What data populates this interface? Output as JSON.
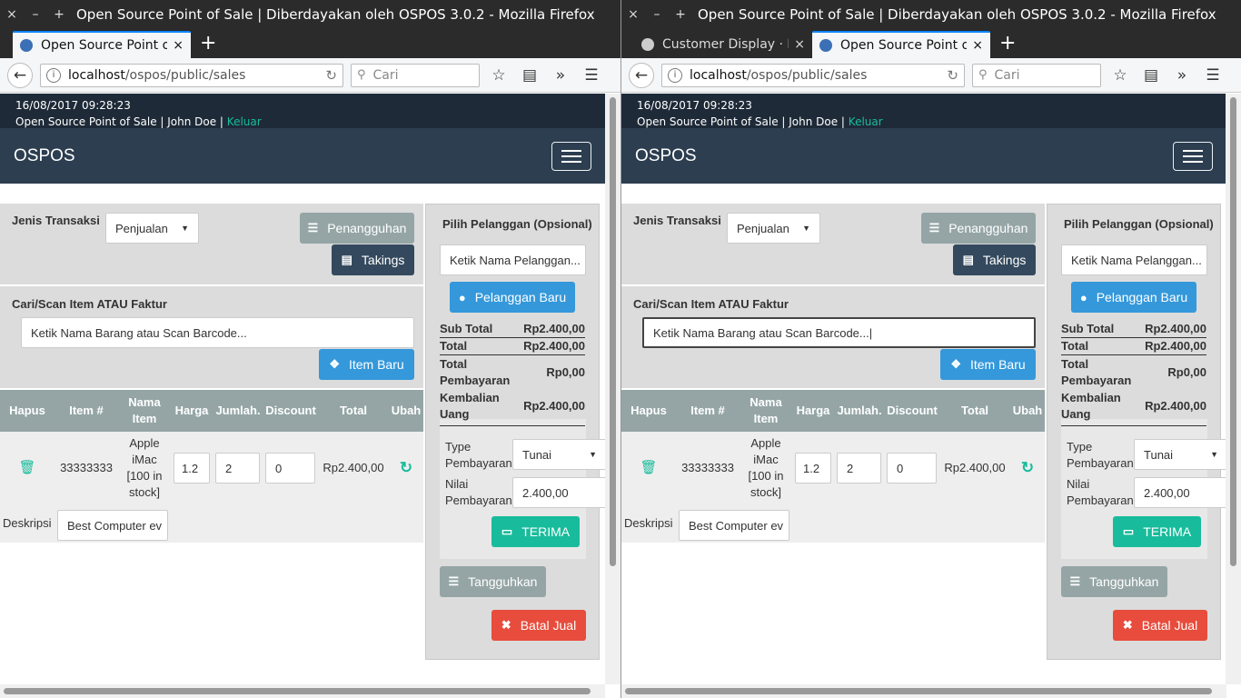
{
  "browser": {
    "title": "Open Source Point of Sale | Diberdayakan oleh OSPOS 3.0.2 - Mozilla Firefox",
    "controls": {
      "close": "×",
      "minimize": "–",
      "maximize": "+"
    },
    "tabs_left": [
      {
        "label": "Open Source Point of Sale | Diberdayakan oleh OSPOS",
        "close": "×"
      }
    ],
    "tabs_right": [
      {
        "label": "Customer Display · Issues",
        "close": "×"
      },
      {
        "label": "Open Source Point of Sale | Diberdayakan oleh OSPOS",
        "close": "×"
      }
    ],
    "new_tab": "+",
    "url_host": "localhost",
    "url_path": "/ospos/public/sales",
    "search_placeholder": "Cari",
    "icons": {
      "back": "arrow-left-icon",
      "reload": "reload-icon",
      "search": "search-icon",
      "bookmark": "star-icon",
      "library": "clipboard-icon",
      "overflow": "chevrons-icon",
      "menu": "hamburger-icon"
    }
  },
  "app": {
    "datetime": "16/08/2017 09:28:23",
    "user_line": "Open Source Point of Sale | John Doe | ",
    "logout": "Keluar",
    "brand": "OSPOS",
    "colors": {
      "topbar": "#1e2a38",
      "navbar": "#2c3e50",
      "accent": "#18bc9c",
      "primary": "#3498db",
      "danger": "#e74c3c"
    }
  },
  "register": {
    "mode_label": "Jenis Transaksi",
    "mode_value": "Penjualan",
    "suspended_btn": "Penangguhan",
    "takings_btn": "Takings",
    "item_label": "Cari/Scan Item ATAU Faktur",
    "item_placeholder_left": "Ketik Nama Barang atau Scan Barcode...",
    "item_value_right": "Ketik Nama Barang atau Scan Barcode...|",
    "new_item_btn": "Item Baru",
    "columns": {
      "delete": "Hapus",
      "item_no": "Item #",
      "name_l1": "Nama",
      "name_l2": "Item",
      "price": "Harga",
      "qty": "Jumlah.",
      "discount": "Discount",
      "total": "Total",
      "update": "Ubah"
    },
    "row": {
      "item_no": "33333333",
      "name_l1": "Apple",
      "name_l2": "iMac",
      "name_l3": "[100 in",
      "name_l4": "stock]",
      "price": "1.2",
      "qty": "2",
      "discount": "0",
      "total": "Rp2.400,00",
      "desc_label": "Deskripsi",
      "desc_value": "Best Computer ev"
    }
  },
  "customer": {
    "title": "Pilih Pelanggan (Opsional)",
    "input_placeholder": "Ketik Nama Pelanggan...",
    "new_customer_btn": "Pelanggan Baru",
    "subtotal_label": "Sub Total",
    "subtotal_value": "Rp2.400,00",
    "total_label": "Total",
    "total_value": "Rp2.400,00",
    "paid_l1": "Total",
    "paid_l2": "Pembayaran",
    "paid_value": "Rp0,00",
    "change_l1": "Kembalian",
    "change_l2": "Uang",
    "change_value": "Rp2.400,00",
    "paytype_l1": "Type",
    "paytype_l2": "Pembayaran",
    "paytype_value": "Tunai",
    "amount_l1": "Nilai",
    "amount_l2": "Pembayaran",
    "amount_value": "2.400,00",
    "accept_btn": "TERIMA",
    "suspend_btn": "Tangguhkan",
    "cancel_btn": "Batal Jual"
  }
}
